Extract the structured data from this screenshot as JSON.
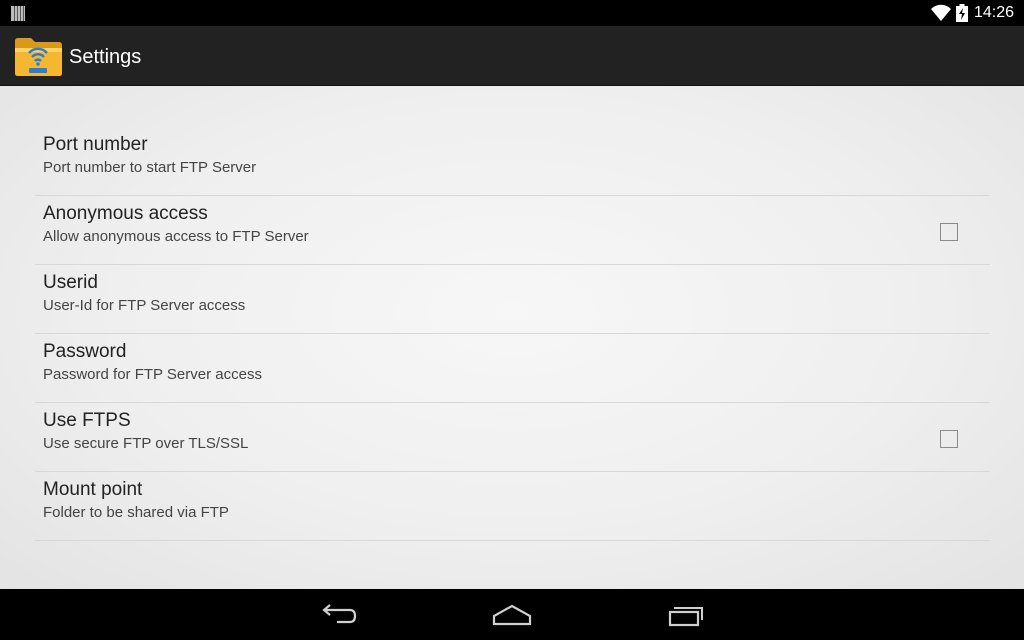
{
  "status_bar": {
    "time": "14:26",
    "icons": [
      "notification-icon",
      "wifi-icon",
      "battery-icon"
    ]
  },
  "action_bar": {
    "title": "Settings",
    "icon": "ftp-folder-icon"
  },
  "preferences": [
    {
      "title": "Port number",
      "summary": "Port number to start FTP Server",
      "has_checkbox": false
    },
    {
      "title": "Anonymous access",
      "summary": "Allow anonymous access to FTP Server",
      "has_checkbox": true,
      "checked": false
    },
    {
      "title": "Userid",
      "summary": "User-Id for FTP Server access",
      "has_checkbox": false
    },
    {
      "title": "Password",
      "summary": "Password for FTP Server access",
      "has_checkbox": false
    },
    {
      "title": "Use FTPS",
      "summary": "Use secure FTP over TLS/SSL",
      "has_checkbox": true,
      "checked": false
    },
    {
      "title": "Mount point",
      "summary": "Folder to be shared via FTP",
      "has_checkbox": false
    }
  ],
  "nav_bar": {
    "buttons": [
      "back-icon",
      "home-icon",
      "recents-icon"
    ]
  },
  "colors": {
    "status_bar_bg": "#000000",
    "action_bar_bg": "#222222",
    "content_bg": "#f0f0f0",
    "folder_yellow": "#f5b731",
    "wifi_blue": "#2a7fd4"
  }
}
